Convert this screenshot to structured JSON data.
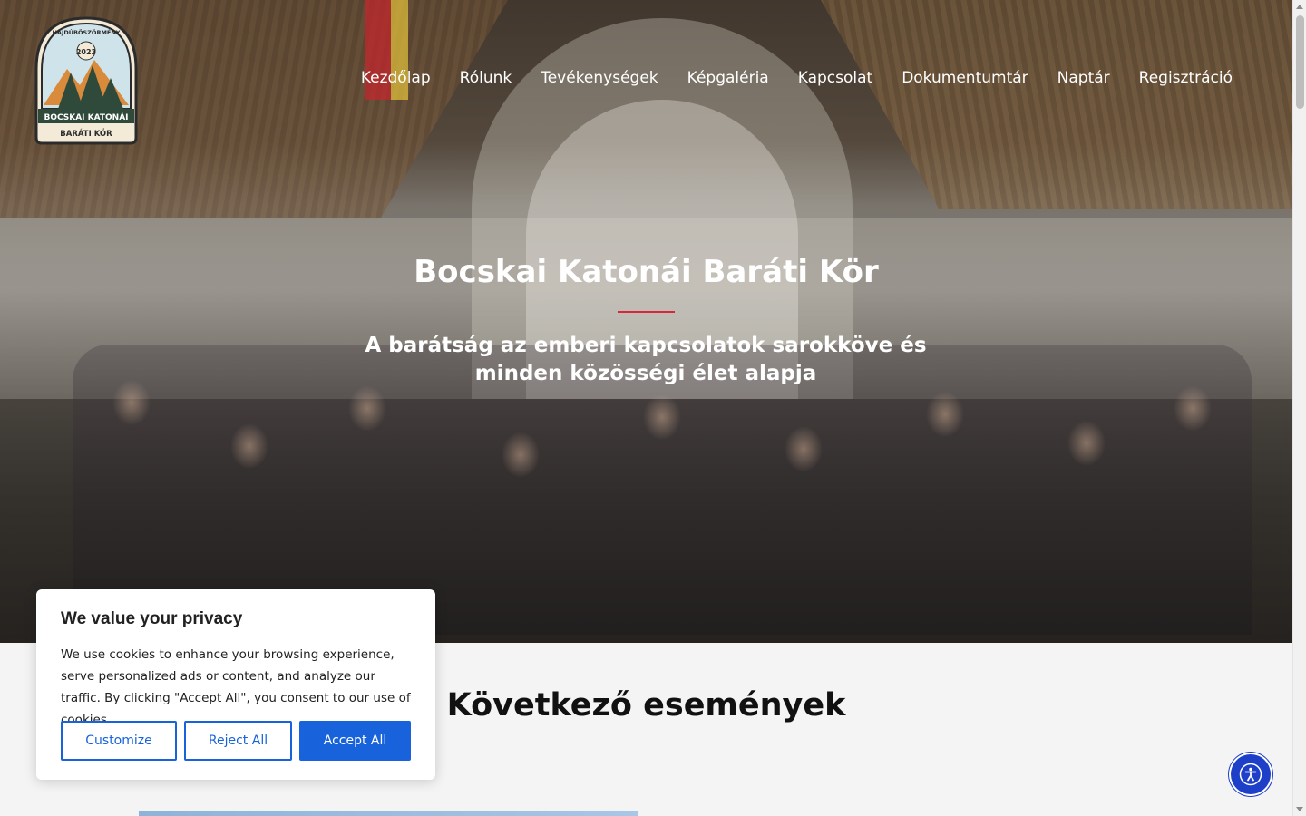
{
  "logo": {
    "top_text": "HAJDÚBÖSZÖRMÉNY",
    "year": "2023",
    "banner": "BOCSKAI KATONÁI",
    "bottom_text": "BARÁTI KÖR"
  },
  "nav": {
    "items": [
      "Kezdőlap",
      "Rólunk",
      "Tevékenységek",
      "Képgaléria",
      "Kapcsolat",
      "Dokumentumtár",
      "Naptár",
      "Regisztráció"
    ]
  },
  "hero": {
    "title": "Bocskai Katonái Baráti Kör",
    "subtitle": "A barátság az emberi kapcsolatok sarokköve és minden közösségi élet alapja",
    "accent_color": "#d9263c"
  },
  "section": {
    "title": "Következő események"
  },
  "cookie": {
    "title": "We value your privacy",
    "text": "We use cookies to enhance your browsing experience, serve personalized ads or content, and analyze our traffic. By clicking \"Accept All\", you consent to our use of cookies.",
    "customize": "Customize",
    "reject": "Reject All",
    "accept": "Accept All",
    "accent_color": "#1863dc"
  },
  "accessibility": {
    "icon": "accessibility-icon"
  }
}
